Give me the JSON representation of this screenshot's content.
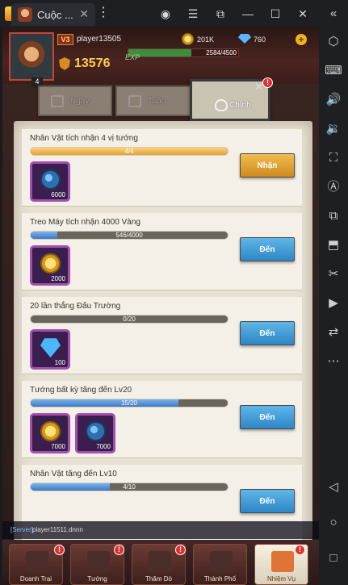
{
  "window": {
    "tab_title": "Cuộc ...",
    "tab_close": "✕",
    "more": "⋮",
    "controls": {
      "account": "◉",
      "menu": "☰",
      "popout": "⧉",
      "minimize": "—",
      "maximize": "☐",
      "close": "✕"
    }
  },
  "sidebar": {
    "collapse": "«",
    "items": [
      "⬡",
      "⌨",
      "🔊",
      "🔉",
      "⛶",
      "Ⓐ",
      "⧉",
      "⬒",
      "✂",
      "▶",
      "⇄",
      "⋯",
      "◁",
      "○",
      "□"
    ]
  },
  "player": {
    "vip": "V3",
    "name": "player13505",
    "level": "4",
    "power": "13576",
    "exp_label": "EXP",
    "exp_text": "2584/4500",
    "exp_progress": 0.574,
    "gold": "201K",
    "gems": "760",
    "add": "+"
  },
  "tabs": [
    {
      "label": "Ngày",
      "icon": "daily-calendar-icon"
    },
    {
      "label": "Tuần",
      "icon": "weekly-calendar-icon"
    },
    {
      "label": "Chính",
      "icon": "main-shield-icon"
    }
  ],
  "tab_close": "✕",
  "alert_mark": "!",
  "quests": [
    {
      "title": "Nhân Vật tích nhận 4 vị tướng",
      "progress_text": "4/4",
      "progress": 1.0,
      "done": true,
      "rewards": [
        {
          "icon": "bomb-icon",
          "qty": "6000"
        }
      ],
      "button": "Nhận"
    },
    {
      "title": "Treo Máy tích nhận 4000 Vàng",
      "progress_text": "546/4000",
      "progress": 0.137,
      "done": false,
      "rewards": [
        {
          "icon": "coin-icon",
          "qty": "2000"
        }
      ],
      "button": "Đến"
    },
    {
      "title": "20 lần thắng Đấu Trường",
      "progress_text": "0/20",
      "progress": 0.0,
      "done": false,
      "rewards": [
        {
          "icon": "gem-icon",
          "qty": "100"
        }
      ],
      "button": "Đến"
    },
    {
      "title": "Tướng bất kỳ tăng đến Lv20",
      "progress_text": "15/20",
      "progress": 0.75,
      "done": false,
      "rewards": [
        {
          "icon": "coin-icon",
          "qty": "7000"
        },
        {
          "icon": "bomb-icon",
          "qty": "7000"
        }
      ],
      "button": "Đến"
    },
    {
      "title": "Nhân Vật tăng đến Lv10",
      "progress_text": "4/10",
      "progress": 0.4,
      "done": false,
      "rewards": [],
      "button": "Đến"
    }
  ],
  "chat": {
    "channel": "[Server]",
    "message": "player11511.dnnn"
  },
  "bottom_nav": [
    {
      "label": "Doanh Trại",
      "alert": true
    },
    {
      "label": "Tướng",
      "alert": true
    },
    {
      "label": "Thăm Dò",
      "alert": true
    },
    {
      "label": "Thành Phố",
      "alert": false
    },
    {
      "label": "Nhiệm Vụ",
      "alert": true,
      "active": true
    }
  ]
}
